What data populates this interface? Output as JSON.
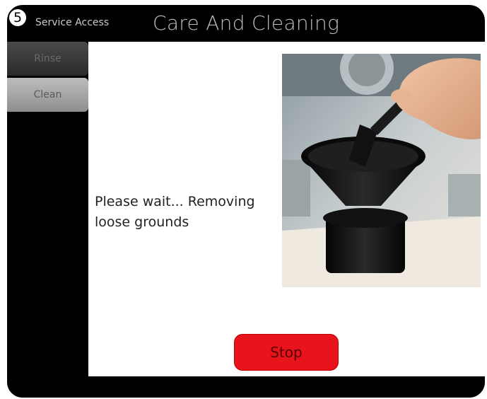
{
  "header": {
    "step_number": "5",
    "service_access_label": "Service Access",
    "title": "Care And Cleaning"
  },
  "sidebar": {
    "items": [
      {
        "label": "Rinse"
      },
      {
        "label": "Clean"
      }
    ]
  },
  "main": {
    "message": "Please wait... Removing loose grounds",
    "photo_description": "hand-cleaning-brewer-funnel-photo"
  },
  "actions": {
    "stop_label": "Stop"
  },
  "colors": {
    "frame": "#000000",
    "stop_button": "#e8141b",
    "content_bg": "#ffffff"
  }
}
